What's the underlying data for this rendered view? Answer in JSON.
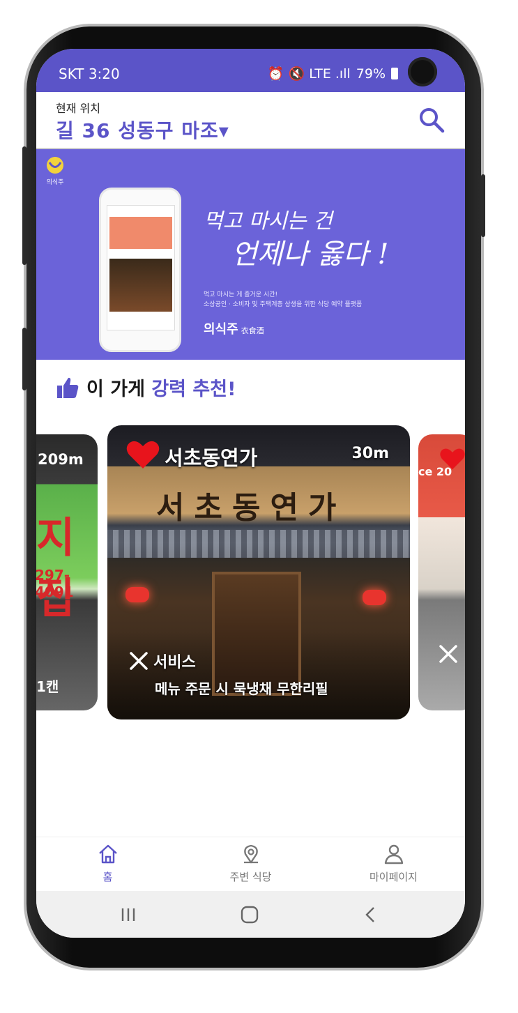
{
  "status": {
    "carrier_time": "SKT 3:20",
    "indicators": "⏰ 🔇 LTE .ıll",
    "battery": "79%"
  },
  "header": {
    "location_label": "현재 위치",
    "location_value": "길 36   성동구 마조▾"
  },
  "banner": {
    "logo_text": "의식주",
    "slogan_line1": "먹고 마시는 건",
    "slogan_line2": "언제나 옳다 !",
    "tagline_line1": "먹고 마시는 게 즐거운 시간!",
    "tagline_line2": "소상공인 · 소비자 및 주택계층 상생을 위한 식당 예약 플랫폼",
    "brand_name": "의식주",
    "brand_hanja": "衣食酒"
  },
  "recommend": {
    "title_prefix": "이 가게 ",
    "title_accent": "강력 추천!"
  },
  "cards": {
    "main": {
      "name": "서초동연가",
      "distance": "30m",
      "sign_text": "서초동연가",
      "service_label": "서비스",
      "service_desc": "메뉴 주문 시 묵냉채 무한리필"
    },
    "left": {
      "distance": "209m",
      "sign_big": "지 집",
      "phone": "297-4091",
      "bottom_text": "1캔"
    },
    "right": {
      "sign_text": "ce 20"
    }
  },
  "tabs": [
    {
      "label": "홈",
      "icon": "home-icon",
      "active": true
    },
    {
      "label": "주변 식당",
      "icon": "map-pin-icon",
      "active": false
    },
    {
      "label": "마이페이지",
      "icon": "user-icon",
      "active": false
    }
  ],
  "colors": {
    "accent": "#5b54c8",
    "banner": "#6b63d9",
    "heart": "#e8141c"
  }
}
